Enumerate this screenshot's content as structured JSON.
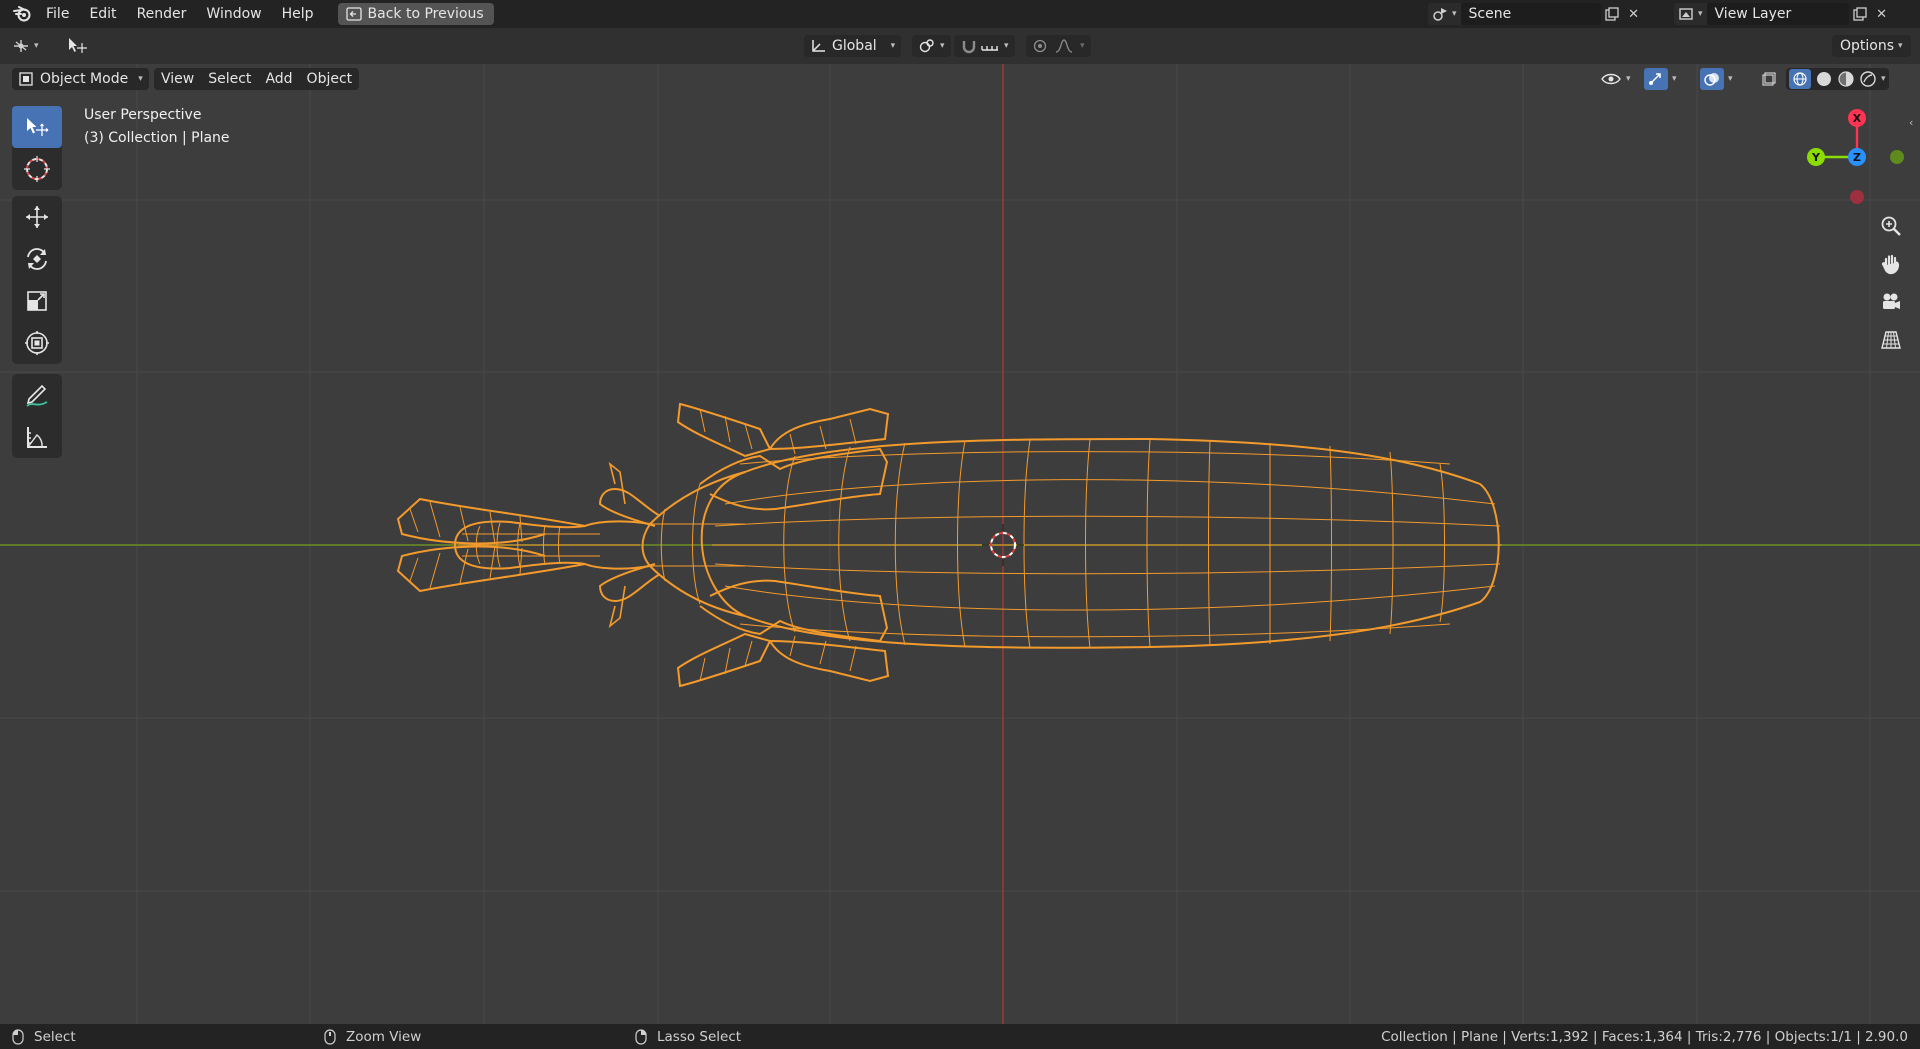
{
  "app": {
    "accent": "#4772b3",
    "selected_outline": "#f39a2c"
  },
  "menubar": {
    "items": [
      "File",
      "Edit",
      "Render",
      "Window",
      "Help"
    ],
    "back_button": "Back to Previous",
    "scene": "Scene",
    "view_layer": "View Layer"
  },
  "tool_header": {
    "transform_orientation": "Global",
    "options_label": "Options"
  },
  "viewport_header": {
    "mode": "Object Mode",
    "menus": [
      "View",
      "Select",
      "Add",
      "Object"
    ]
  },
  "viewport": {
    "view_name": "User Perspective",
    "collection_info": "(3) Collection | Plane",
    "gizmo": {
      "x_label": "X",
      "y_label": "Y",
      "z_label": "Z",
      "x_color": "#ff3352",
      "y_color": "#8bdc00",
      "z_color": "#2890ff"
    }
  },
  "toolbar": {
    "tools": [
      "select-box-icon",
      "cursor-icon",
      "move-icon",
      "rotate-icon",
      "scale-icon",
      "transform-icon",
      "annotate-icon",
      "measure-icon"
    ]
  },
  "statusbar": {
    "left_action": "Select",
    "middle_action": "Zoom View",
    "right_action": "Lasso Select",
    "stats": "Collection | Plane | Verts:1,392 | Faces:1,364 | Tris:2,776 | Objects:1/1 | 2.90.0"
  }
}
